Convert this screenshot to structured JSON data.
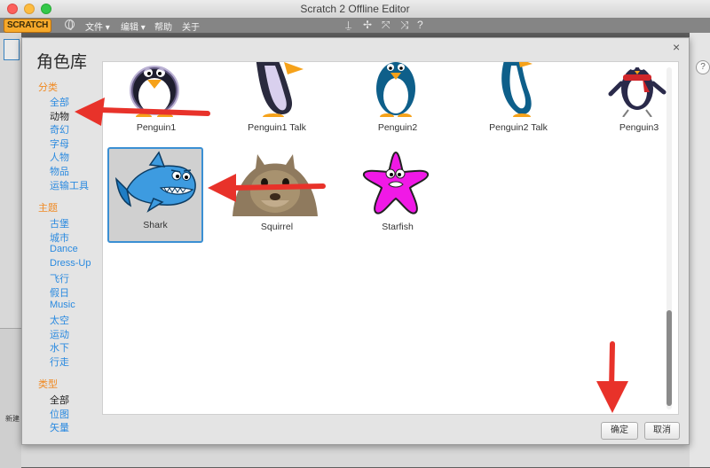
{
  "window": {
    "title": "Scratch 2 Offline Editor"
  },
  "menubar": {
    "logo": "SCRATCH",
    "items": [
      {
        "label": "文件 ▾"
      },
      {
        "label": "编辑 ▾"
      },
      {
        "label": "帮助"
      },
      {
        "label": "关于"
      }
    ]
  },
  "background": {
    "new_sprite_label": "新建",
    "help_glyph": "?"
  },
  "dialog": {
    "title": "角色库",
    "close_glyph": "×",
    "category_heading": "分类",
    "categories": [
      "全部",
      "动物",
      "奇幻",
      "字母",
      "人物",
      "物品",
      "运输工具"
    ],
    "selected_category": "动物",
    "theme_heading": "主题",
    "themes": [
      "古堡",
      "城市",
      "Dance",
      "Dress-Up",
      "飞行",
      "假日",
      "Music",
      "太空",
      "运动",
      "水下",
      "行走"
    ],
    "type_heading": "类型",
    "types": [
      "全部",
      "位图",
      "矢量"
    ],
    "selected_type": "全部",
    "ok_label": "确定",
    "cancel_label": "取消"
  },
  "sprites": [
    {
      "name": "Penguin1"
    },
    {
      "name": "Penguin1 Talk"
    },
    {
      "name": "Penguin2"
    },
    {
      "name": "Penguin2 Talk"
    },
    {
      "name": "Penguin3"
    },
    {
      "name": "Shark"
    },
    {
      "name": "Squirrel"
    },
    {
      "name": "Starfish"
    }
  ],
  "selected_sprite": "Shark",
  "colors": {
    "accent_blue": "#3a8fd3",
    "category_link": "#2a8ae0",
    "heading_orange": "#f08a23",
    "annotation_red": "#e8322a"
  }
}
